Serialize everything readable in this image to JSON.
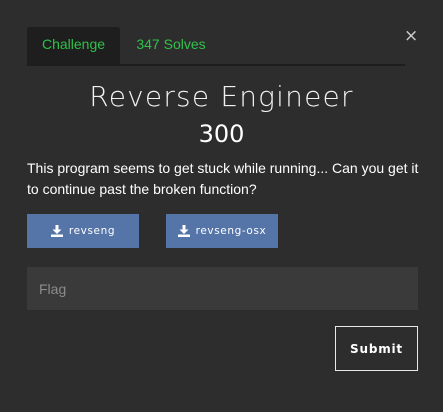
{
  "modal": {
    "close_glyph": "×"
  },
  "tabs": [
    {
      "label": "Challenge",
      "active": true
    },
    {
      "label": "347 Solves",
      "active": false
    }
  ],
  "challenge": {
    "name": "Reverse Engineer",
    "points": "300",
    "description": "This program seems to get stuck while running... Can you get it to continue past the broken function?"
  },
  "files": [
    {
      "label": "revseng",
      "icon": "download-icon"
    },
    {
      "label": "revseng-osx",
      "icon": "download-icon"
    }
  ],
  "flag_input": {
    "placeholder": "Flag",
    "value": ""
  },
  "submit_label": "Submit",
  "colors": {
    "background": "#2d2d2d",
    "accent_green": "#2fc14a",
    "file_button": "#5574a8",
    "input_bg": "#3a3a3a"
  }
}
